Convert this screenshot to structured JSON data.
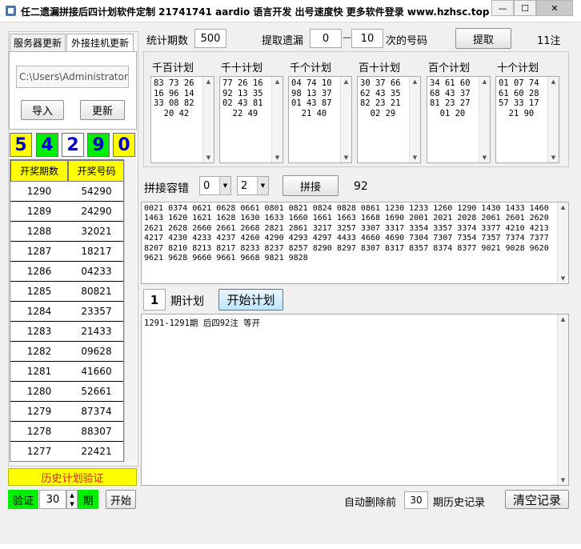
{
  "window": {
    "title": "任二遗漏拼接后四计划软件定制 21741741 aardio 语言开发 出号速度快 更多软件登录 www.hzhsc.top",
    "min_glyph": "—",
    "max_glyph": "☐",
    "close_glyph": "✕"
  },
  "left": {
    "tabs": [
      "服务器更新",
      "外接挂机更新"
    ],
    "path_value": "C:\\Users\\Administrator\\",
    "import_label": "导入",
    "update_label": "更新",
    "digits": [
      "5",
      "4",
      "2",
      "9",
      "0"
    ],
    "digit_colors": [
      "#ffff00",
      "#00ee00",
      "#ffffff",
      "#00ee00",
      "#ffff00"
    ],
    "digit_text_colors": [
      "#0000cc",
      "#0000cc",
      "#0000cc",
      "#0000cc",
      "#0000cc"
    ],
    "table": {
      "headers": [
        "开奖期数",
        "开奖号码"
      ],
      "rows": [
        [
          "1290",
          "54290"
        ],
        [
          "1289",
          "24290"
        ],
        [
          "1288",
          "32021"
        ],
        [
          "1287",
          "18217"
        ],
        [
          "1286",
          "04233"
        ],
        [
          "1285",
          "80821"
        ],
        [
          "1284",
          "23357"
        ],
        [
          "1283",
          "21433"
        ],
        [
          "1282",
          "09628"
        ],
        [
          "1281",
          "41660"
        ],
        [
          "1280",
          "52661"
        ],
        [
          "1279",
          "87374"
        ],
        [
          "1278",
          "88307"
        ],
        [
          "1277",
          "22421"
        ]
      ]
    },
    "history_label": "历史计划验证",
    "verify_label": "验证",
    "verify_value": "30",
    "period_label": "期",
    "start_label": "开始"
  },
  "top": {
    "stat_label": "统计期数",
    "stat_value": "500",
    "extract_miss_label": "提取遗漏",
    "miss_from": "0",
    "dash": "—",
    "miss_to": "10",
    "suffix_label": "次的号码",
    "extract_button": "提取",
    "count_label": "11注"
  },
  "plans": [
    {
      "title": "千百计划",
      "text": "83 73 26\n16 96 14\n33 08 82\n  20 42"
    },
    {
      "title": "千十计划",
      "text": "77 26 16\n92 13 35\n02 43 81\n  22 49"
    },
    {
      "title": "千个计划",
      "text": "04 74 10\n98 13 37\n01 43 87\n  21 40"
    },
    {
      "title": "百十计划",
      "text": "30 37 66\n62 43 35\n82 23 21\n  02 29"
    },
    {
      "title": "百个计划",
      "text": "34 61 60\n68 43 37\n81 23 27\n  01 20"
    },
    {
      "title": "十个计划",
      "text": "01 07 74\n61 60 28\n57 33 17\n  21 90"
    }
  ],
  "concat": {
    "tolerance_label": "拼接容错",
    "combo1": "0",
    "combo2": "2",
    "button": "拼接",
    "result_count": "92"
  },
  "result_text": "0021 0374 0621 0628 0661 0801 0821 0824 0828 0861 1230 1233 1260 1290 1430 1433 1460\n1463 1620 1621 1628 1630 1633 1660 1661 1663 1668 1690 2001 2021 2028 2061 2601 2620\n2621 2628 2660 2661 2668 2821 2861 3217 3257 3307 3317 3354 3357 3374 3377 4210 4213\n4217 4230 4233 4237 4260 4290 4293 4297 4433 4660 4690 7304 7307 7354 7357 7374 7377\n8207 8210 8213 8217 8233 8237 8257 8290 8297 8307 8317 8357 8374 8377 9021 9028 9620\n9621 9628 9660 9661 9668 9821 9828",
  "plan_run": {
    "num": "1",
    "label": "期计划",
    "button": "开始计划"
  },
  "log_text": "1291-1291期 后四92注 等开",
  "bottom": {
    "auto_delete_label": "自动删除前",
    "auto_delete_value": "30",
    "history_suffix": "期历史记录",
    "clear_button": "清空记录"
  }
}
